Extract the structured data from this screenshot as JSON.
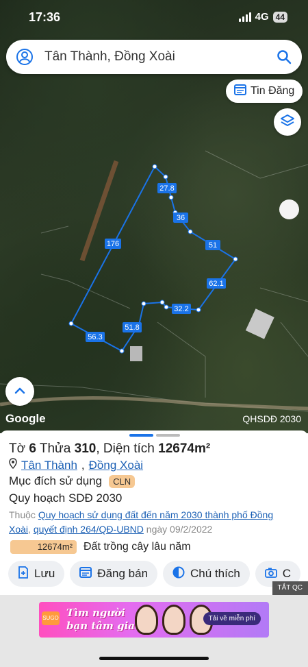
{
  "status": {
    "time": "17:36",
    "network": "4G",
    "battery": "44"
  },
  "search": {
    "text": "Tân Thành, Đồng Xoài"
  },
  "map": {
    "tin_dang_label": "Tin Đăng",
    "google_label": "Google",
    "overlay_label": "QHSDĐ 2030",
    "edge_lengths": [
      "27.8",
      "36",
      "51",
      "62.1",
      "32.2",
      "51.8",
      "56.3",
      "176"
    ],
    "boundary_color": "#1a73e8"
  },
  "sheet": {
    "title_prefix": "Tờ",
    "sheet_no": "6",
    "parcel_label": "Thửa",
    "parcel_no": "310",
    "area_label": "Diện tích",
    "area_value": "12674m²",
    "ward": "Tân Thành",
    "city": "Đồng Xoài",
    "purpose_label": "Mục đích sử dụng",
    "purpose_code": "CLN",
    "plan_label": "Quy hoạch SDĐ 2030",
    "belongs_prefix": "Thuộc",
    "plan_link": "Quy hoạch sử dụng đất đến năm 2030 thành phố Đồng Xoài",
    "decision_link": "quyết định 264/QĐ-UBND",
    "decision_date": "ngày 09/2/2022",
    "area_chip": "12674m²",
    "land_type": "Đất trồng cây lâu năm"
  },
  "actions": {
    "save": "Lưu",
    "sell": "Đăng bán",
    "legend": "Chú thích",
    "capture": "C"
  },
  "ad": {
    "hide_label": "TẮT QC",
    "headline_1": "Tìm người",
    "headline_2": "bạn tâm giao",
    "cta": "Tải về miễn phí",
    "logo": "SUGO"
  }
}
